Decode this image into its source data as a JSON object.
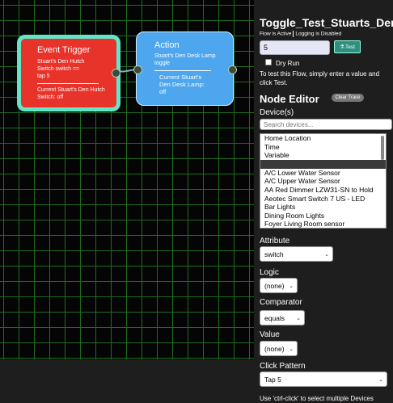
{
  "canvas": {
    "trigger": {
      "title": "Event Trigger",
      "line1": "Stuart's Den Hutch",
      "line2": "Switch switch ==",
      "line3": "tap 5",
      "current1": "Current Stuart's Den Hutch",
      "current2": "Switch: off"
    },
    "action": {
      "title": "Action",
      "line1": "Stuart's Den Desk Lamp",
      "line2": "toggle",
      "current1": "Current Stuart's",
      "current2": "Den Desk Lamp:",
      "current3": "off"
    }
  },
  "panel": {
    "flow_title": "Toggle_Test_Stuarts_Den_D",
    "flow_active": "Flow is Active",
    "logging": "Logging is Disabled",
    "test_value": "5",
    "test_button": "Test",
    "dry_run": "Dry Run",
    "test_hint": "To test this Flow, simply enter a value and click Test.",
    "node_editor": "Node Editor",
    "clear_trace": "Clear Trace",
    "devices_label": "Device(s)",
    "search_placeholder": "Search devices...",
    "devices": [
      "Home Location",
      "Time",
      "Variable",
      "",
      "A/C Lower Water Sensor",
      "A/C Upper Water Sensor",
      "AA Red Dimmer LZW31-SN to Hold",
      "Aeotec Smart Switch 7 US - LED",
      "Bar Lights",
      "Dining Room Lights",
      "Foyer Living Room sensor"
    ],
    "attribute_label": "Attribute",
    "attribute_value": "switch",
    "logic_label": "Logic",
    "logic_value": "(none)",
    "comparator_label": "Comparator",
    "comparator_value": "equals",
    "value_label": "Value",
    "value_value": "(none)",
    "click_pattern_label": "Click Pattern",
    "click_pattern_value": "Tap 5",
    "multi_hint": "Use 'ctrl-click' to select multiple Devices"
  }
}
